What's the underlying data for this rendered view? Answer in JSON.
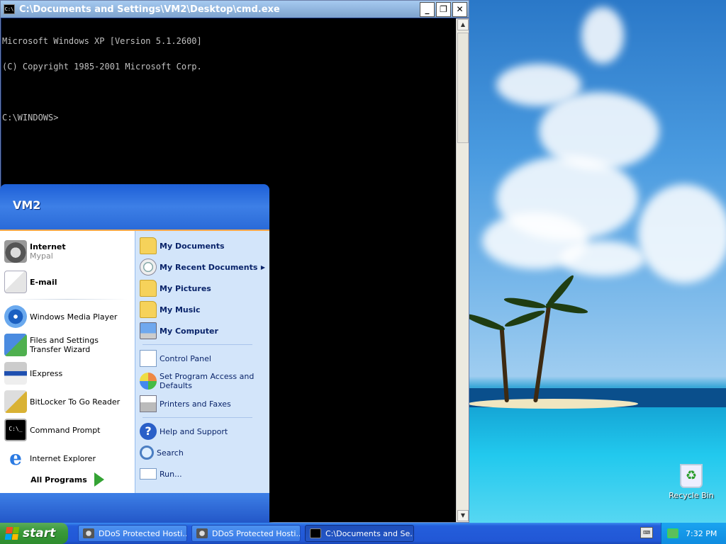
{
  "cmd": {
    "title": "C:\\Documents and Settings\\VM2\\Desktop\\cmd.exe",
    "icon_text": "C:\\",
    "lines": [
      "Microsoft Windows XP [Version 5.1.2600]",
      "(C) Copyright 1985-2001 Microsoft Corp.",
      "",
      "C:\\WINDOWS>"
    ],
    "controls": {
      "minimize": "_",
      "restore": "❐",
      "close": "✕"
    }
  },
  "start_menu": {
    "user": "VM2",
    "pinned": [
      {
        "label": "Internet",
        "sub": "Mypal",
        "icon": "raccoon-icon"
      },
      {
        "label": "E-mail",
        "icon": "email-icon"
      }
    ],
    "recent": [
      {
        "label": "Windows Media Player",
        "icon": "media-player-icon"
      },
      {
        "label": "Files and Settings Transfer Wizard",
        "icon": "transfer-wizard-icon"
      },
      {
        "label": "IExpress",
        "icon": "iexpress-icon"
      },
      {
        "label": "BitLocker To Go Reader",
        "icon": "bitlocker-icon"
      },
      {
        "label": "Command Prompt",
        "icon": "cmd-icon"
      },
      {
        "label": "Internet Explorer",
        "icon": "ie-icon"
      }
    ],
    "all_programs": "All Programs",
    "places": [
      {
        "label": "My Documents",
        "icon": "folder-icon"
      },
      {
        "label": "My Recent Documents",
        "icon": "recent-docs-icon",
        "arrow": "▶"
      },
      {
        "label": "My Pictures",
        "icon": "folder-icon"
      },
      {
        "label": "My Music",
        "icon": "folder-icon"
      },
      {
        "label": "My Computer",
        "icon": "computer-icon"
      }
    ],
    "system": [
      {
        "label": "Control Panel",
        "icon": "control-panel-icon"
      },
      {
        "label": "Set Program Access and Defaults",
        "icon": "program-access-icon"
      },
      {
        "label": "Printers and Faxes",
        "icon": "printer-icon"
      }
    ],
    "help": [
      {
        "label": "Help and Support",
        "icon": "help-icon"
      },
      {
        "label": "Search",
        "icon": "search-icon"
      },
      {
        "label": "Run...",
        "icon": "run-icon"
      }
    ]
  },
  "desktop": {
    "recycle_bin": "Recycle Bin"
  },
  "taskbar": {
    "start": "start",
    "tasks": [
      {
        "label": "DDoS Protected Hosti..."
      },
      {
        "label": "DDoS Protected Hosti..."
      },
      {
        "label": "C:\\Documents and Se..."
      }
    ],
    "clock": "7:32 PM"
  }
}
